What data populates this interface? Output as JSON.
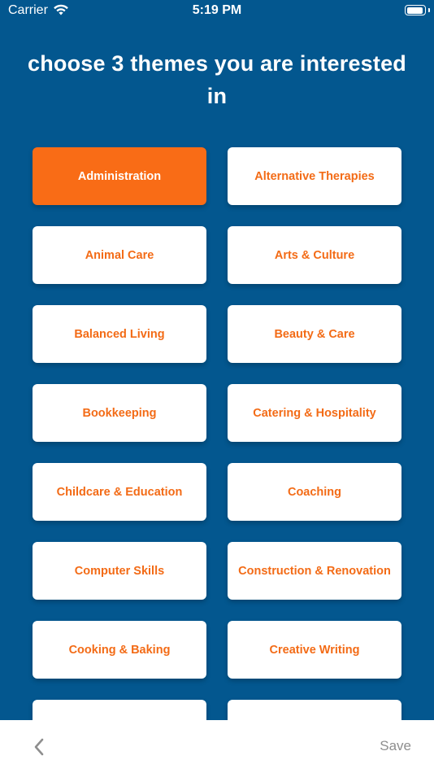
{
  "status_bar": {
    "carrier": "Carrier",
    "time": "5:19 PM",
    "battery_level": 0.95
  },
  "title": "choose 3 themes you are interested in",
  "themes": [
    {
      "label": "Administration",
      "selected": true
    },
    {
      "label": "Alternative Therapies",
      "selected": false
    },
    {
      "label": "Animal Care",
      "selected": false
    },
    {
      "label": "Arts & Culture",
      "selected": false
    },
    {
      "label": "Balanced Living",
      "selected": false
    },
    {
      "label": "Beauty & Care",
      "selected": false
    },
    {
      "label": "Bookkeeping",
      "selected": false
    },
    {
      "label": "Catering & Hospitality",
      "selected": false
    },
    {
      "label": "Childcare & Education",
      "selected": false
    },
    {
      "label": "Coaching",
      "selected": false
    },
    {
      "label": "Computer Skills",
      "selected": false
    },
    {
      "label": "Construction & Renovation",
      "selected": false
    },
    {
      "label": "Cooking & Baking",
      "selected": false
    },
    {
      "label": "Creative Writing",
      "selected": false
    },
    {
      "label": "",
      "selected": false
    },
    {
      "label": "",
      "selected": false
    }
  ],
  "bottom_bar": {
    "back_icon": "chevron-left-icon",
    "save_label": "Save"
  },
  "colors": {
    "background": "#03578f",
    "accent": "#f96c16",
    "card": "#ffffff",
    "save_text": "#8e8e8e"
  }
}
